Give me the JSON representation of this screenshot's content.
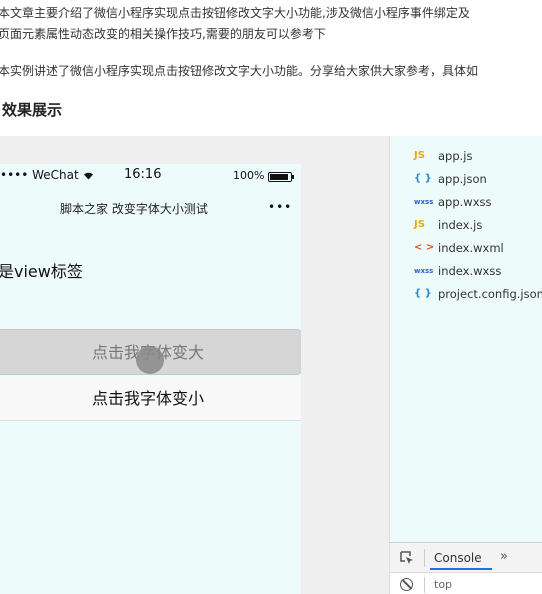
{
  "article": {
    "line1": "本文章主要介绍了微信小程序实现点击按钮修改文字大小功能,涉及微信小程序事件绑定及",
    "line2": "页面元素属性动态改变的相关操作技巧,需要的朋友可以参考下",
    "line3": "本实例讲述了微信小程序实现点击按钮修改文字大小功能。分享给大家供大家参考，具体如",
    "heading": "效果展示"
  },
  "phone": {
    "carrier": "•••• WeChat",
    "time": "16:16",
    "battery_percent": "100%",
    "nav_title": "脚本之家 改变字体大小测试",
    "nav_menu": "•••",
    "view_text": "是view标签",
    "button_big": "点击我字体变大",
    "button_small": "点击我字体变小"
  },
  "file_tree": [
    {
      "icon": "JS",
      "icon_color": "#e6a817",
      "name": "app.js"
    },
    {
      "icon": "{ }",
      "icon_color": "#2b8ad8",
      "name": "app.json"
    },
    {
      "icon": "wxss",
      "icon_color": "#2b5fd8",
      "name": "app.wxss"
    },
    {
      "icon": "JS",
      "icon_color": "#e6a817",
      "name": "index.js"
    },
    {
      "icon": "< >",
      "icon_color": "#e0522b",
      "name": "index.wxml"
    },
    {
      "icon": "wxss",
      "icon_color": "#2b5fd8",
      "name": "index.wxss"
    },
    {
      "icon": "{ }",
      "icon_color": "#2b8ad8",
      "name": "project.config.json"
    }
  ],
  "devtools": {
    "console_tab": "Console",
    "more_tabs": "»",
    "context": "top"
  }
}
